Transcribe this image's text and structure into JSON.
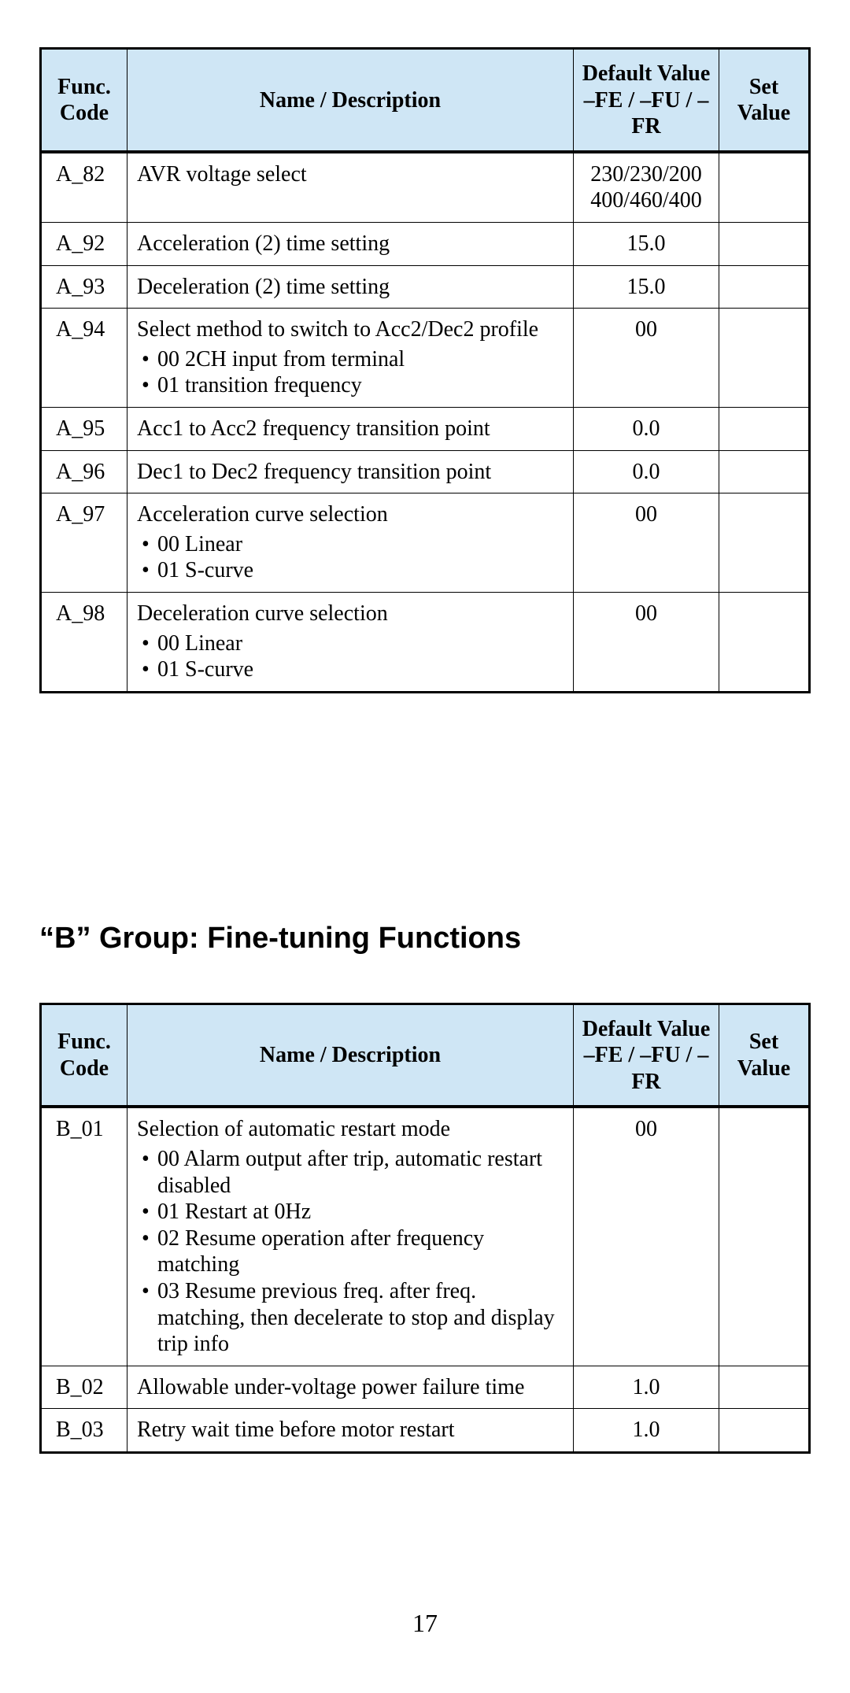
{
  "headers": {
    "code": "Func. Code",
    "name": "Name / Description",
    "default": "Default Value –FE / –FU / –FR",
    "set": "Set Value"
  },
  "tableA": {
    "rows": [
      {
        "code": "A_82",
        "name": "AVR voltage select",
        "default": "230/230/200 400/460/400",
        "set": ""
      },
      {
        "code": "A_92",
        "name": "Acceleration (2) time setting",
        "default": "15.0",
        "set": ""
      },
      {
        "code": "A_93",
        "name": "Deceleration (2) time setting",
        "default": "15.0",
        "set": ""
      },
      {
        "code": "A_94",
        "name": "Select method to switch to Acc2/Dec2 profile",
        "bullets": [
          "00 2CH input from terminal",
          "01 transition frequency"
        ],
        "default": "00",
        "set": ""
      },
      {
        "code": "A_95",
        "name": "Acc1 to Acc2 frequency transition point",
        "default": "0.0",
        "set": ""
      },
      {
        "code": "A_96",
        "name": "Dec1 to Dec2 frequency transition point",
        "default": "0.0",
        "set": ""
      },
      {
        "code": "A_97",
        "name": "Acceleration curve selection",
        "inline_opts": [
          "00 Linear",
          "01 S-curve"
        ],
        "default": "00",
        "set": ""
      },
      {
        "code": "A_98",
        "name": "Deceleration curve selection",
        "inline_opts": [
          "00 Linear",
          "01 S-curve"
        ],
        "default": "00",
        "set": ""
      }
    ]
  },
  "sectionB": {
    "title": "“B” Group: Fine-tuning Functions"
  },
  "tableB": {
    "rows": [
      {
        "code": "B_01",
        "name": "Selection of automatic restart mode",
        "bullets": [
          "00 Alarm output after trip, automatic restart disabled",
          "01 Restart at 0Hz",
          "02 Resume operation after frequency matching",
          "03 Resume previous freq. after freq. matching, then decelerate to stop and display trip info"
        ],
        "default": "00",
        "set": ""
      },
      {
        "code": "B_02",
        "name": "Allowable under-voltage power failure time",
        "default": "1.0",
        "set": ""
      },
      {
        "code": "B_03",
        "name": "Retry wait time before motor restart",
        "default": "1.0",
        "set": ""
      }
    ]
  },
  "pageNumber": "17"
}
